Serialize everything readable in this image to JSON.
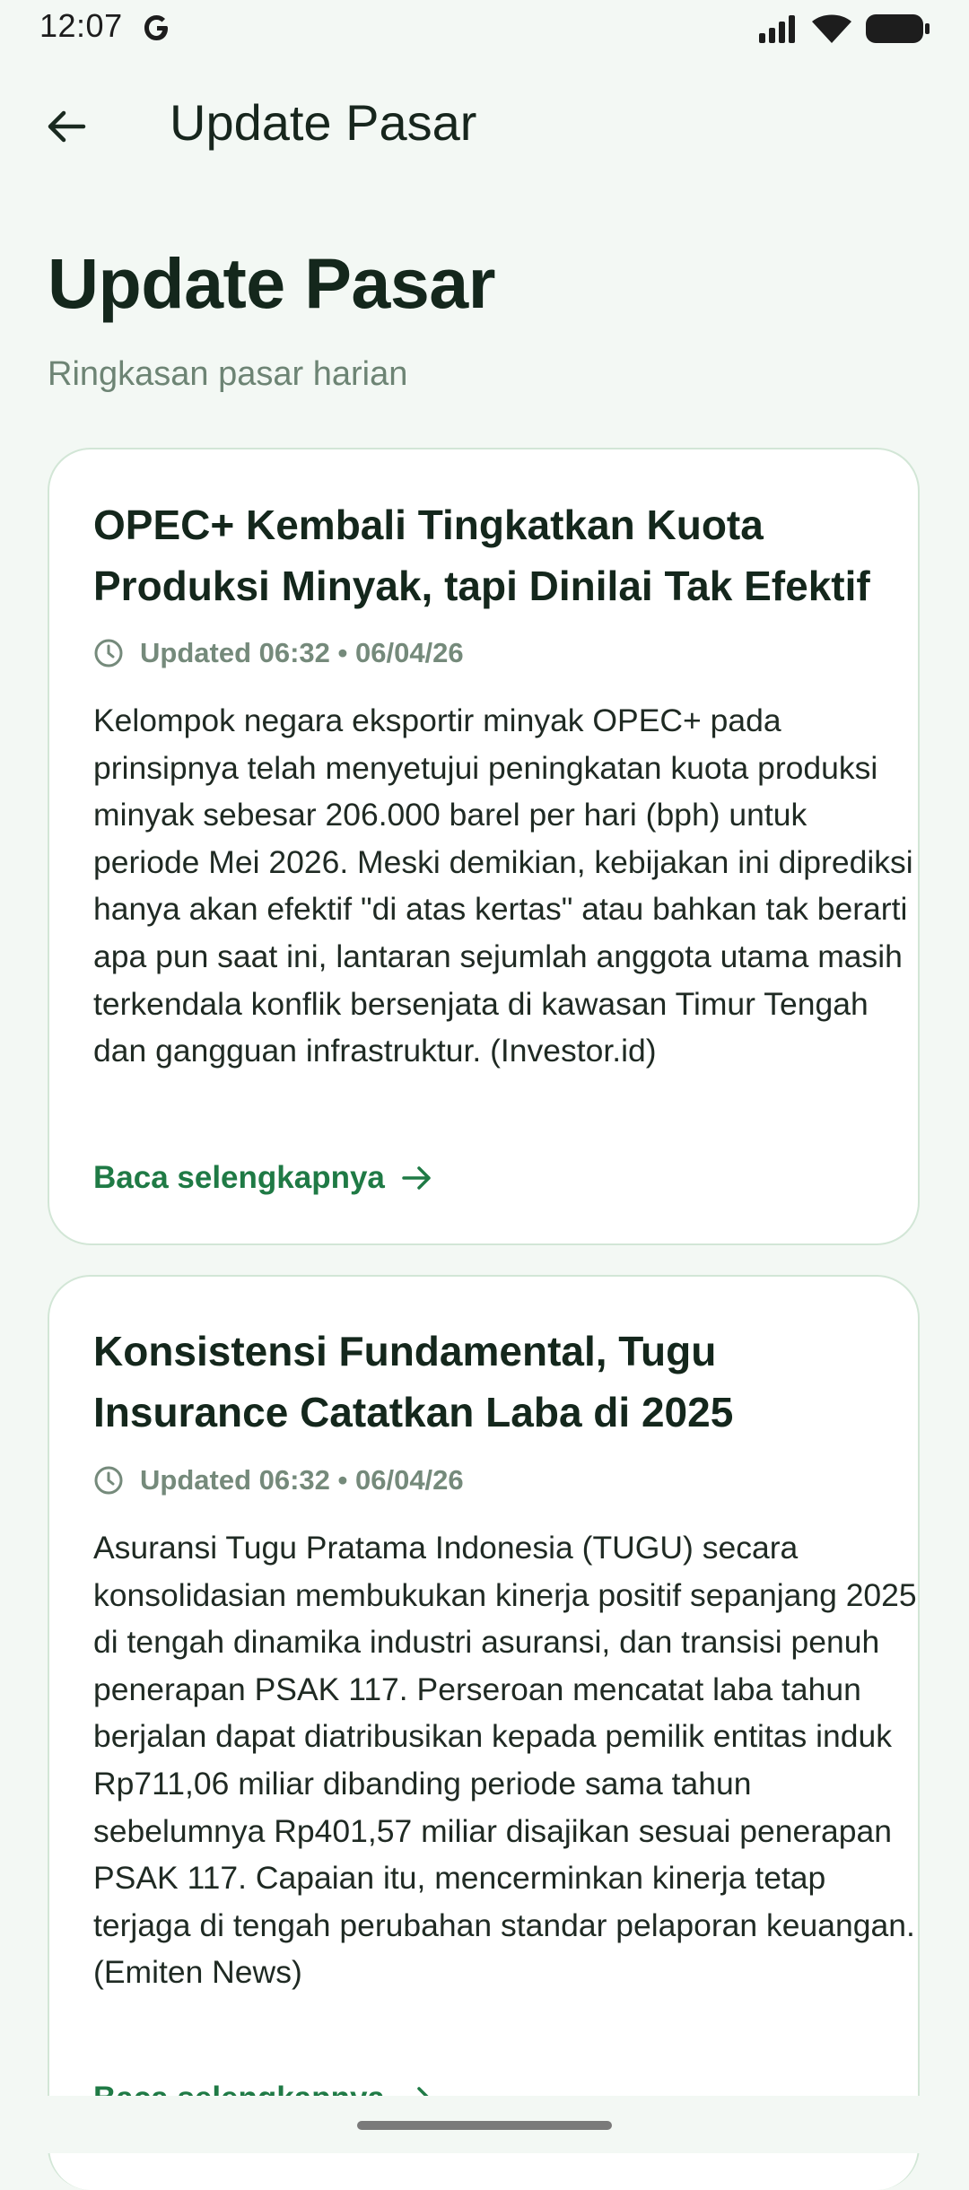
{
  "status_bar": {
    "time": "12:07",
    "icons": [
      "google-g-icon",
      "signal-icon",
      "wifi-icon",
      "battery-icon"
    ]
  },
  "app_bar": {
    "back_icon": "arrow-left-icon",
    "title": "Update Pasar"
  },
  "header": {
    "title": "Update Pasar",
    "subtitle": "Ringkasan pasar harian"
  },
  "articles": [
    {
      "title": "OPEC+ Kembali Tingkatkan Kuota Produksi Minyak, tapi Dinilai Tak Efektif",
      "meta": "Updated 06:32 • 06/04/26",
      "body": "Kelompok negara eksportir minyak OPEC+ pada prinsipnya telah menyetujui peningkatan kuota produksi minyak sebesar 206.000 barel per hari (bph) untuk periode Mei 2026. Meski demikian, kebijakan ini diprediksi hanya akan efektif \"di atas kertas\" atau bahkan tak berarti apa pun saat ini, lantaran sejumlah anggota utama masih terkendala konflik bersenjata di kawasan Timur Tengah dan gangguan infrastruktur. (Investor.id)",
      "read_more": "Baca selengkapnya"
    },
    {
      "title": "Konsistensi Fundamental, Tugu Insurance Catatkan Laba di 2025",
      "meta": "Updated 06:32 • 06/04/26",
      "body": "Asuransi Tugu Pratama Indonesia (TUGU) secara konsolidasian membukukan kinerja positif sepanjang 2025 di tengah dinamika industri asuransi, dan transisi penuh penerapan PSAK 117. Perseroan mencatat laba tahun berjalan dapat diatribusikan kepada pemilik entitas induk Rp711,06 miliar dibanding periode sama tahun sebelumnya Rp401,57 miliar disajikan sesuai penerapan PSAK 117. Capaian itu, mencerminkan kinerja tetap terjaga di tengah perubahan standar pelaporan keuangan. (Emiten News)",
      "read_more": "Baca selengkapnya"
    }
  ],
  "colors": {
    "background": "#f3f8f4",
    "accent": "#1f7a45",
    "card_border": "#d2e6d6",
    "meta_text": "#758a7b"
  }
}
